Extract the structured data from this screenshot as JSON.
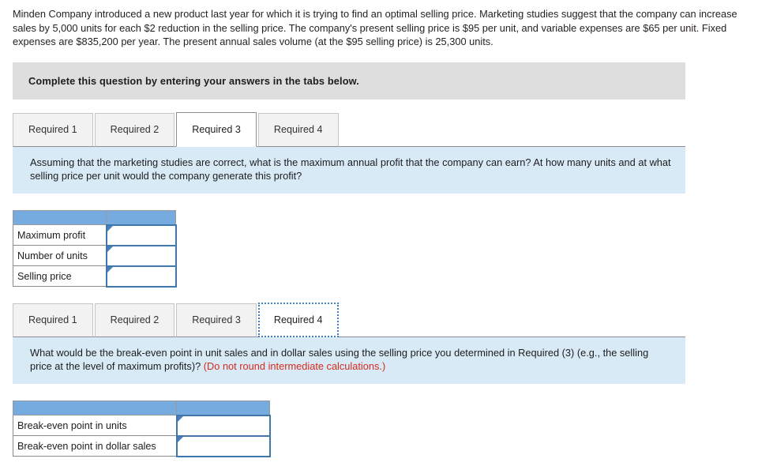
{
  "problem": {
    "statement": "Minden Company introduced a new product last year for which it is trying to find an optimal selling price. Marketing studies suggest that the company can increase sales by 5,000 units for each $2 reduction in the selling price. The company's present selling price is $95 per unit, and variable expenses are $65 per unit. Fixed expenses are $835,200 per year. The present annual sales volume (at the $95 selling price) is 25,300 units."
  },
  "instruction_banner": {
    "text": "Complete this question by entering your answers in the tabs below."
  },
  "colors": {
    "banner_gray": "#dedede",
    "panel_blue": "#d9eaf7",
    "table_header_blue": "#76abe0",
    "input_border_blue": "#3f77ab",
    "note_red": "#d52b1e",
    "tab_inactive_gray": "#f2f2f2",
    "tab_border_gray": "#8d8d8d"
  },
  "sections": [
    {
      "id": "required-3",
      "tabs": [
        {
          "label": "Required 1",
          "state": "inactive"
        },
        {
          "label": "Required 2",
          "state": "inactive"
        },
        {
          "label": "Required 3",
          "state": "active"
        },
        {
          "label": "Required 4",
          "state": "inactive"
        }
      ],
      "prompt": "Assuming that the marketing studies are correct, what is the maximum annual profit that the company can earn? At how many units and at what selling price per unit would the company generate this profit?",
      "prompt_note": "",
      "table": {
        "header_cells": [
          "",
          ""
        ],
        "label_col_width": 118,
        "input_col_width": 88,
        "rows": [
          {
            "label": "Maximum profit",
            "value": ""
          },
          {
            "label": "Number of units",
            "value": ""
          },
          {
            "label": "Selling price",
            "value": ""
          }
        ]
      }
    },
    {
      "id": "required-4",
      "tabs": [
        {
          "label": "Required 1",
          "state": "inactive"
        },
        {
          "label": "Required 2",
          "state": "inactive"
        },
        {
          "label": "Required 3",
          "state": "inactive"
        },
        {
          "label": "Required 4",
          "state": "focused"
        }
      ],
      "prompt": "What would be the break-even point in unit sales and in dollar sales using the selling price you determined in Required (3) (e.g., the selling price at the level of maximum profits)? ",
      "prompt_note": "(Do not round intermediate calculations.)",
      "table": {
        "header_cells": [
          "",
          ""
        ],
        "label_col_width": 207,
        "input_col_width": 118,
        "rows": [
          {
            "label": "Break-even point in units",
            "value": ""
          },
          {
            "label": "Break-even point in dollar sales",
            "value": ""
          }
        ]
      }
    }
  ]
}
